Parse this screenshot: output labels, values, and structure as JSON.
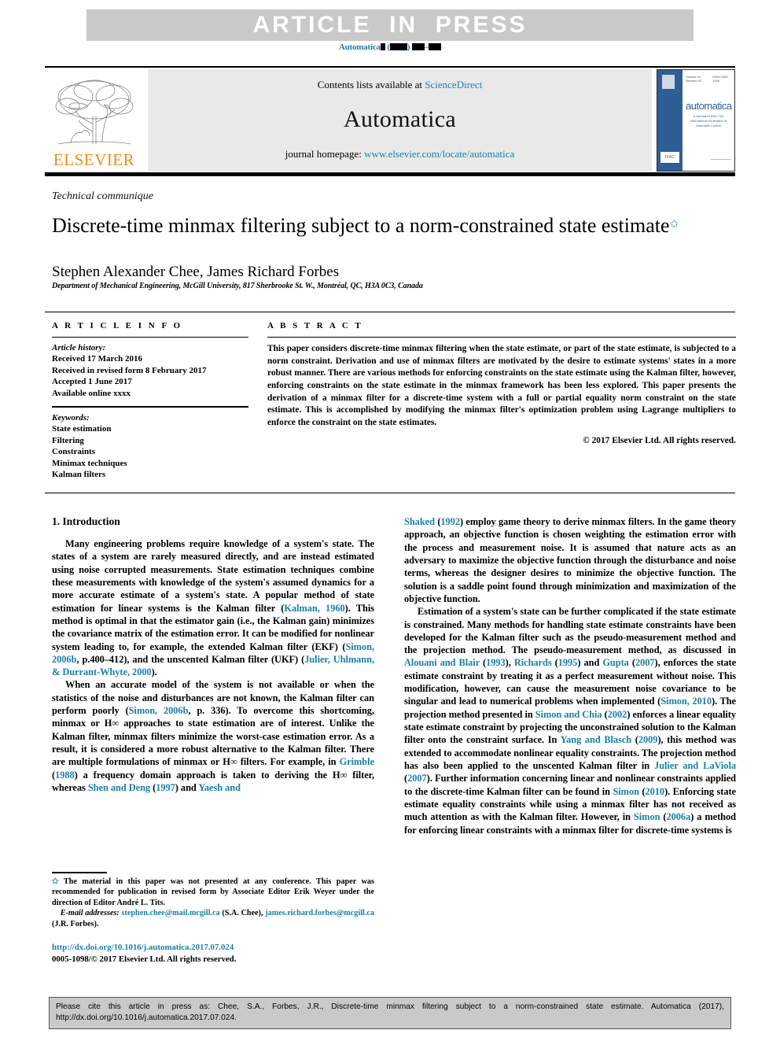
{
  "banner": {
    "article_in_press": "ARTICLE  IN  PRESS",
    "running_head_prefix": "Automatica",
    "running_head_suffix": ") "
  },
  "masthead": {
    "publisher": "ELSEVIER",
    "contents_prefix": "Contents lists available at ",
    "contents_link": "ScienceDirect",
    "journal_name": "Automatica",
    "homepage_prefix": "journal homepage: ",
    "homepage_link": "www.elsevier.com/locate/automatica",
    "cover": {
      "title": "automatica",
      "subtitle": "A Journal of IFAC The International Federation of Automatic Control",
      "volume_line_left": "Volume 00 · Number 00",
      "volume_line_right": "ISSN 0005-1098",
      "ifac_label": "IFAC"
    }
  },
  "article": {
    "section_type": "Technical communique",
    "title": "Discrete-time minmax filtering subject to a norm-constrained state estimate",
    "title_star": "✩",
    "authors": "Stephen Alexander Chee, James Richard Forbes",
    "affiliation": "Department of Mechanical Engineering, McGill University, 817 Sherbrooke St. W., Montréal, QC, H3A 0C3, Canada"
  },
  "info": {
    "heading": "A R T I C L E    I N F O",
    "history_label": "Article history:",
    "history": [
      "Received 17 March 2016",
      "Received in revised form 8 February 2017",
      "Accepted 1 June 2017",
      "Available online xxxx"
    ],
    "keywords_label": "Keywords:",
    "keywords": [
      "State estimation",
      "Filtering",
      "Constraints",
      "Minimax techniques",
      "Kalman filters"
    ]
  },
  "abstract": {
    "heading": "A B S T R A C T",
    "text": "This paper considers discrete-time minmax filtering when the state estimate, or part of the state estimate, is subjected to a norm constraint. Derivation and use of minmax filters are motivated by the desire to estimate systems' states in a more robust manner. There are various methods for enforcing constraints on the state estimate using the Kalman filter, however, enforcing constraints on the state estimate in the minmax framework has been less explored. This paper presents the derivation of a minmax filter for a discrete-time system with a full or partial equality norm constraint on the state estimate. This is accomplished by modifying the minmax filter's optimization problem using Lagrange multipliers to enforce the constraint on the state estimates.",
    "copyright": "© 2017 Elsevier Ltd. All rights reserved."
  },
  "body": {
    "section_heading": "1. Introduction",
    "left_p1_a": "Many engineering problems require knowledge of a system's state. The states of a system are rarely measured directly, and are instead estimated using noise corrupted measurements. State estimation techniques combine these measurements with knowledge of the system's assumed dynamics for a more accurate estimate of a system's state. A popular method of state estimation for linear systems is the Kalman filter (",
    "left_p1_ref1": "Kalman, 1960",
    "left_p1_b": "). This method is optimal in that the estimator gain (i.e., the Kalman gain) minimizes the covariance matrix of the estimation error. It can be modified for nonlinear system leading to, for example, the extended Kalman filter (EKF) (",
    "left_p1_ref2": "Simon, 2006b",
    "left_p1_c": ", p.400–412), and the unscented Kalman filter (UKF) (",
    "left_p1_ref3": "Julier, Uhlmann, & Durrant-Whyte, 2000",
    "left_p1_d": ").",
    "left_p2_a": "When an accurate model of the system is not available or when the statistics of the noise and disturbances are not known, the Kalman filter can perform poorly (",
    "left_p2_ref1": "Simon, 2006b",
    "left_p2_b": ", p. 336). To overcome this shortcoming, minmax or H∞ approaches to state estimation are of interest. Unlike the Kalman filter, minmax filters minimize the worst-case estimation error. As a result, it is considered a more robust alternative to the Kalman filter. There are multiple formulations of minmax or H∞ filters. For example, in ",
    "left_p2_ref2": "Grimble",
    "left_p2_c": " (",
    "left_p2_ref2yr": "1988",
    "left_p2_d": ") a frequency domain approach is taken to deriving the H∞ filter, whereas ",
    "left_p2_ref3": "Shen and Deng",
    "left_p2_e": " (",
    "left_p2_ref3yr": "1997",
    "left_p2_f": ") and ",
    "left_p2_ref4": "Yaesh and",
    "right_p1_ref0": "Shaked",
    "right_p1_a": " (",
    "right_p1_ref0yr": "1992",
    "right_p1_b": ") employ game theory to derive minmax filters. In the game theory approach, an objective function is chosen weighting the estimation error with the process and measurement noise. It is assumed that nature acts as an adversary to maximize the objective function through the disturbance and noise terms, whereas the designer desires to minimize the objective function. The solution is a saddle point found through minimization and maximization of the objective function.",
    "right_p2_a": "Estimation of a system's state can be further complicated if the state estimate is constrained. Many methods for handling state estimate constraints have been developed for the Kalman filter such as the pseudo-measurement method and the projection method. The pseudo-measurement method, as discussed in ",
    "right_p2_ref1": "Alouani and Blair",
    "right_p2_b": " (",
    "right_p2_ref1yr": "1993",
    "right_p2_c": "), ",
    "right_p2_ref2": "Richards",
    "right_p2_d": " (",
    "right_p2_ref2yr": "1995",
    "right_p2_e": ") and ",
    "right_p2_ref3": "Gupta",
    "right_p2_f": " (",
    "right_p2_ref3yr": "2007",
    "right_p2_g": "), enforces the state estimate constraint by treating it as a perfect measurement without noise. This modification, however, can cause the measurement noise covariance to be singular and lead to numerical problems when implemented (",
    "right_p2_ref4": "Simon, 2010",
    "right_p2_h": "). The projection method presented in ",
    "right_p2_ref5": "Simon and Chia",
    "right_p2_i": " (",
    "right_p2_ref5yr": "2002",
    "right_p2_j": ") enforces a linear equality state estimate constraint by projecting the unconstrained solution to the Kalman filter onto the constraint surface. In ",
    "right_p2_ref6": "Yang and Blasch",
    "right_p2_k": " (",
    "right_p2_ref6yr": "2009",
    "right_p2_l": "), this method was extended to accommodate nonlinear equality constraints. The projection method has also been applied to the unscented Kalman filter in ",
    "right_p2_ref7": "Julier and LaViola",
    "right_p2_m": " (",
    "right_p2_ref7yr": "2007",
    "right_p2_n": "). Further information concerning linear and nonlinear constraints applied to the discrete-time Kalman filter can be found in ",
    "right_p2_ref8": "Simon",
    "right_p2_o": " (",
    "right_p2_ref8yr": "2010",
    "right_p2_p": "). Enforcing state estimate equality constraints while using a minmax filter has not received as much attention as with the Kalman filter. However, in ",
    "right_p2_ref9": "Simon",
    "right_p2_q": " (",
    "right_p2_ref9yr": "2006a",
    "right_p2_r": ") a method for enforcing linear constraints with a minmax filter for discrete-time systems is"
  },
  "footnote": {
    "star": "✩",
    "text": " The material in this paper was not presented at any conference. This paper was recommended for publication in revised form by Associate Editor Erik Weyer under the direction of Editor André L. Tits.",
    "email_label": "E-mail addresses:",
    "email1": "stephen.chee@mail.mcgill.ca",
    "email1_owner": " (S.A. Chee),",
    "email2": "james.richard.forbes@mcgill.ca",
    "email2_owner": " (J.R. Forbes)."
  },
  "doi_block": {
    "doi_url": "http://dx.doi.org/10.1016/j.automatica.2017.07.024",
    "issn_line": "0005-1098/© 2017 Elsevier Ltd. All rights reserved."
  },
  "citation_footer": {
    "text": "Please cite this article in press as: Chee, S.A., Forbes, J.R., Discrete-time minmax filtering subject to a norm-constrained state estimate. Automatica (2017), http://dx.doi.org/10.1016/j.automatica.2017.07.024."
  },
  "colors": {
    "link_blue": "#1b7fa8",
    "banner_gray": "#c9c9c9",
    "masthead_gray": "#e9e9e9",
    "elsevier_orange": "#f08a1c",
    "cover_blue": "#2d5f96"
  }
}
